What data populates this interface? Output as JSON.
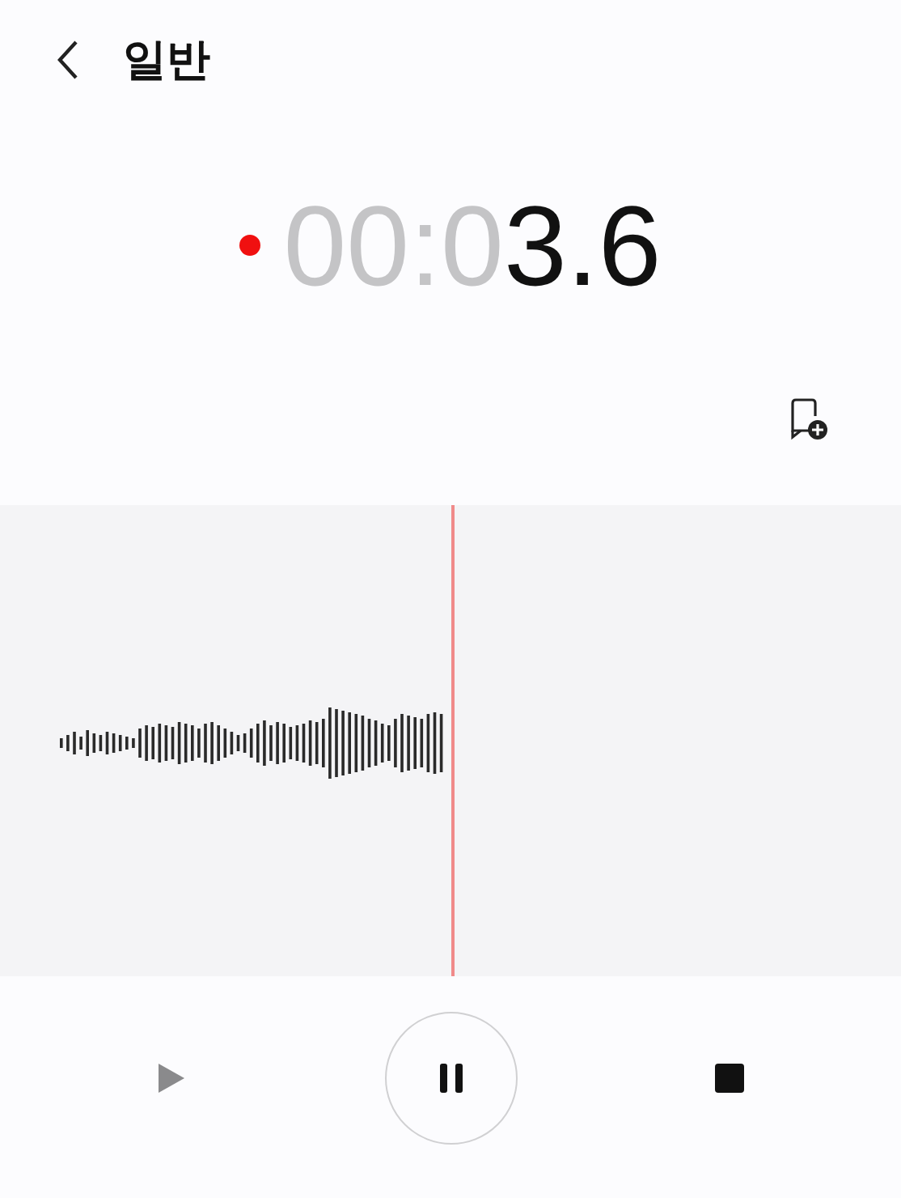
{
  "header": {
    "title": "일반"
  },
  "timer": {
    "recording": true,
    "elapsed_dim": "00:0",
    "elapsed": "3.6"
  },
  "controls": [
    {
      "kind": "play",
      "disabled": true
    },
    {
      "kind": "pause",
      "disabled": false
    },
    {
      "kind": "stop",
      "disabled": false
    }
  ]
}
